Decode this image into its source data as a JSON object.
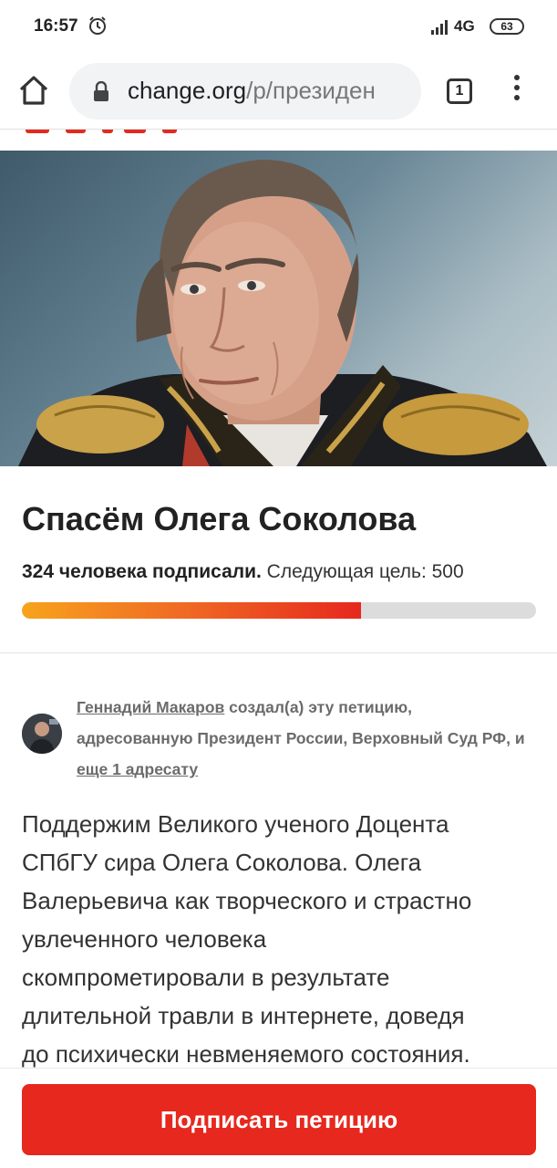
{
  "status_bar": {
    "time": "16:57",
    "network": "4G",
    "battery": "63"
  },
  "browser": {
    "url_domain": "change.org",
    "url_path": "/p/президен",
    "tab_count": "1"
  },
  "petition": {
    "title": "Спасём Олега Соколова",
    "signed_text": "324 человека подписали.",
    "goal_text": "Следующая цель: 500",
    "signed_count": 324,
    "goal": 500,
    "progress_fraction": 0.66
  },
  "author": {
    "name": "Геннадий Макаров",
    "text_part1": " создал(а) эту петицию, адресованную Президент России, Верховный Суд РФ, и ",
    "more_link": "еще 1 адресату"
  },
  "description_lines": [
    "Поддержим Великого ученого Доцента",
    "СПбГУ  сира Олега Соколова.  Олега",
    "Валерьевича как творческого и страстно",
    "увлеченного человека",
    "скомпрометировали в результате",
    "длительной травли в интернете, доведя",
    "до  психически невменяемого состояния."
  ],
  "actions": {
    "sign_button": "Подписать петицию"
  },
  "colors": {
    "brand_red": "#e6281e",
    "progress_start": "#f7a31c",
    "progress_end": "#e6281e"
  }
}
